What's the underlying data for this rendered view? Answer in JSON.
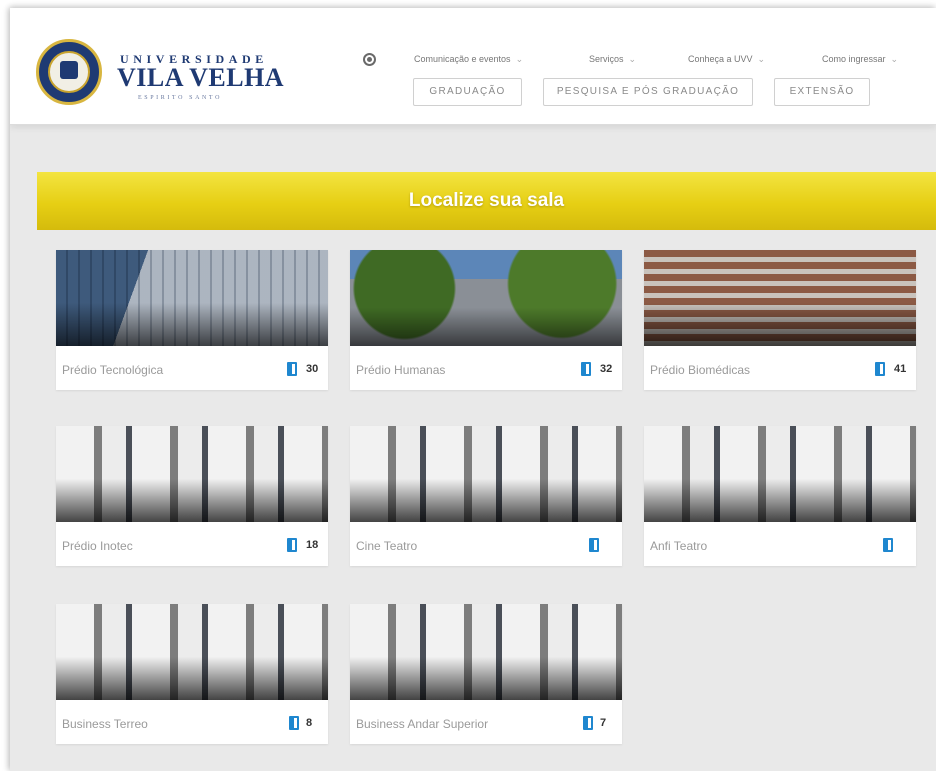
{
  "brand": {
    "logo_top": "UNIVERSIDADE",
    "logo_main": "VILA VELHA",
    "logo_sub": "ESPIRITO SANTO"
  },
  "topnav": [
    {
      "label": "Comunicação e eventos"
    },
    {
      "label": "Serviços"
    },
    {
      "label": "Conheça a UVV"
    },
    {
      "label": "Como ingressar"
    }
  ],
  "nav_buttons": [
    {
      "label": "GRADUAÇÃO"
    },
    {
      "label": "PESQUISA E PÓS GRADUAÇÃO"
    },
    {
      "label": "EXTENSÃO"
    }
  ],
  "banner": {
    "title": "Localize sua sala"
  },
  "cards": [
    {
      "name": "Prédio Tecnológica",
      "count": "30",
      "icon": "door-icon"
    },
    {
      "name": "Prédio Humanas",
      "count": "32",
      "icon": "door-icon"
    },
    {
      "name": "Prédio Biomédicas",
      "count": "41",
      "icon": "door-icon"
    },
    {
      "name": "Prédio Inotec",
      "count": "18",
      "icon": "door-icon"
    },
    {
      "name": "Cine Teatro",
      "count": "",
      "icon": "door-icon"
    },
    {
      "name": "Anfi Teatro",
      "count": "",
      "icon": "door-icon"
    },
    {
      "name": "Business Terreo",
      "count": "8",
      "icon": "door-icon"
    },
    {
      "name": "Business Andar Superior",
      "count": "7",
      "icon": "door-icon"
    }
  ],
  "colors": {
    "banner_yellow": "#e6cf14",
    "brand_blue": "#1f3a73",
    "door_icon_blue": "#1f87cf"
  }
}
